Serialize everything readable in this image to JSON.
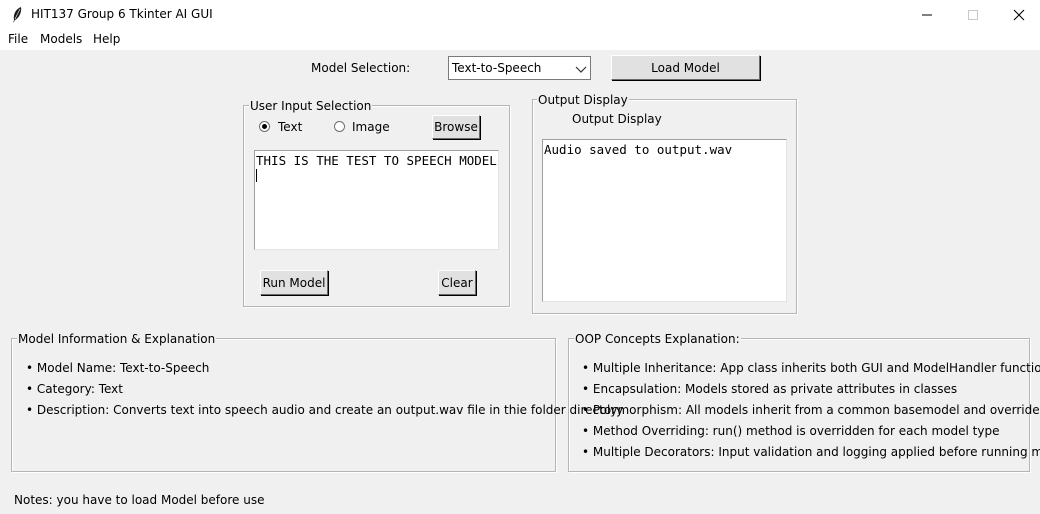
{
  "window": {
    "title": "HIT137 Group 6 Tkinter AI GUI",
    "app_icon": "tk-feather-icon"
  },
  "menu": {
    "items": [
      "File",
      "Models",
      "Help"
    ]
  },
  "model_selection": {
    "label": "Model Selection:",
    "selected": "Text-to-Speech",
    "load_button": "Load Model"
  },
  "input_frame": {
    "title": "User Input Selection",
    "radio_text": "Text",
    "radio_image": "Image",
    "selected_mode": "Text",
    "browse_button": "Browse",
    "input_text": "THIS IS THE TEST TO SPEECH MODEL",
    "run_button": "Run Model",
    "clear_button": "Clear"
  },
  "output_frame": {
    "title": "Output Display",
    "heading": "Output Display",
    "output_text": "Audio saved to output.wav"
  },
  "model_info": {
    "title": "Model Information & Explanation",
    "items": [
      "Model Name: Text-to-Speech",
      "Category: Text",
      "Description: Converts text into speech audio and create an output.wav file in thie folder directory"
    ]
  },
  "oop": {
    "title": "OOP Concepts Explanation:",
    "items": [
      "Multiple Inheritance: App class inherits both GUI and ModelHandler functionality",
      "Encapsulation: Models stored as private attributes in classes",
      "Polymorphism: All models inherit from a common basemodel and override run()",
      "Method Overriding: run() method is overridden for each model type",
      "Multiple Decorators: Input validation and logging applied before running models"
    ]
  },
  "notes": "Notes: you have to load Model before use"
}
